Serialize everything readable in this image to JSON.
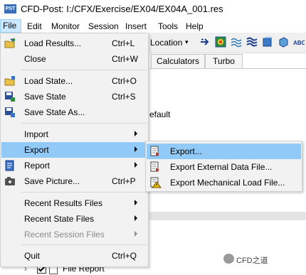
{
  "window": {
    "app_icon_text": "PST",
    "title": "CFD-Post: I:/CFX/Exercise/EX04/EX04A_001.res"
  },
  "menubar": [
    "File",
    "Edit",
    "Monitor",
    "Session",
    "Insert",
    "Tools",
    "Help"
  ],
  "toolbar": {
    "location_label": "Location"
  },
  "tabs": [
    "Calculators",
    "Turbo"
  ],
  "background": {
    "default_text": "efault",
    "tree_item": "File Report"
  },
  "watermark": "CFD之道",
  "file_menu": {
    "items": [
      {
        "label": "Load Results...",
        "shortcut": "Ctrl+L",
        "icon": "open-results-icon"
      },
      {
        "label": "Close",
        "shortcut": "Ctrl+W"
      },
      {
        "label": "Load State...",
        "shortcut": "Ctrl+O",
        "icon": "open-state-icon"
      },
      {
        "label": "Save State",
        "shortcut": "Ctrl+S",
        "icon": "save-state-icon"
      },
      {
        "label": "Save State As...",
        "shortcut": "",
        "icon": "save-state-as-icon"
      },
      {
        "label": "Import",
        "submenu": true
      },
      {
        "label": "Export",
        "submenu": true,
        "highlighted": true
      },
      {
        "label": "Report",
        "submenu": true,
        "icon": "report-icon"
      },
      {
        "label": "Save Picture...",
        "shortcut": "Ctrl+P",
        "icon": "camera-icon"
      },
      {
        "label": "Recent Results Files",
        "submenu": true
      },
      {
        "label": "Recent State Files",
        "submenu": true
      },
      {
        "label": "Recent Session Files",
        "submenu": true,
        "disabled": true
      },
      {
        "label": "Quit",
        "shortcut": "Ctrl+Q"
      }
    ]
  },
  "export_submenu": {
    "items": [
      {
        "label": "Export...",
        "highlighted": true,
        "icon": "export-icon"
      },
      {
        "label": "Export External Data File...",
        "icon": "export-external-data-icon"
      },
      {
        "label": "Export Mechanical Load File...",
        "icon": "export-mechanical-load-icon"
      }
    ]
  },
  "colors": {
    "highlight": "#91c9f7",
    "menu_bg": "#f2f2f2",
    "menubar_file_active": "#cce8ff"
  }
}
